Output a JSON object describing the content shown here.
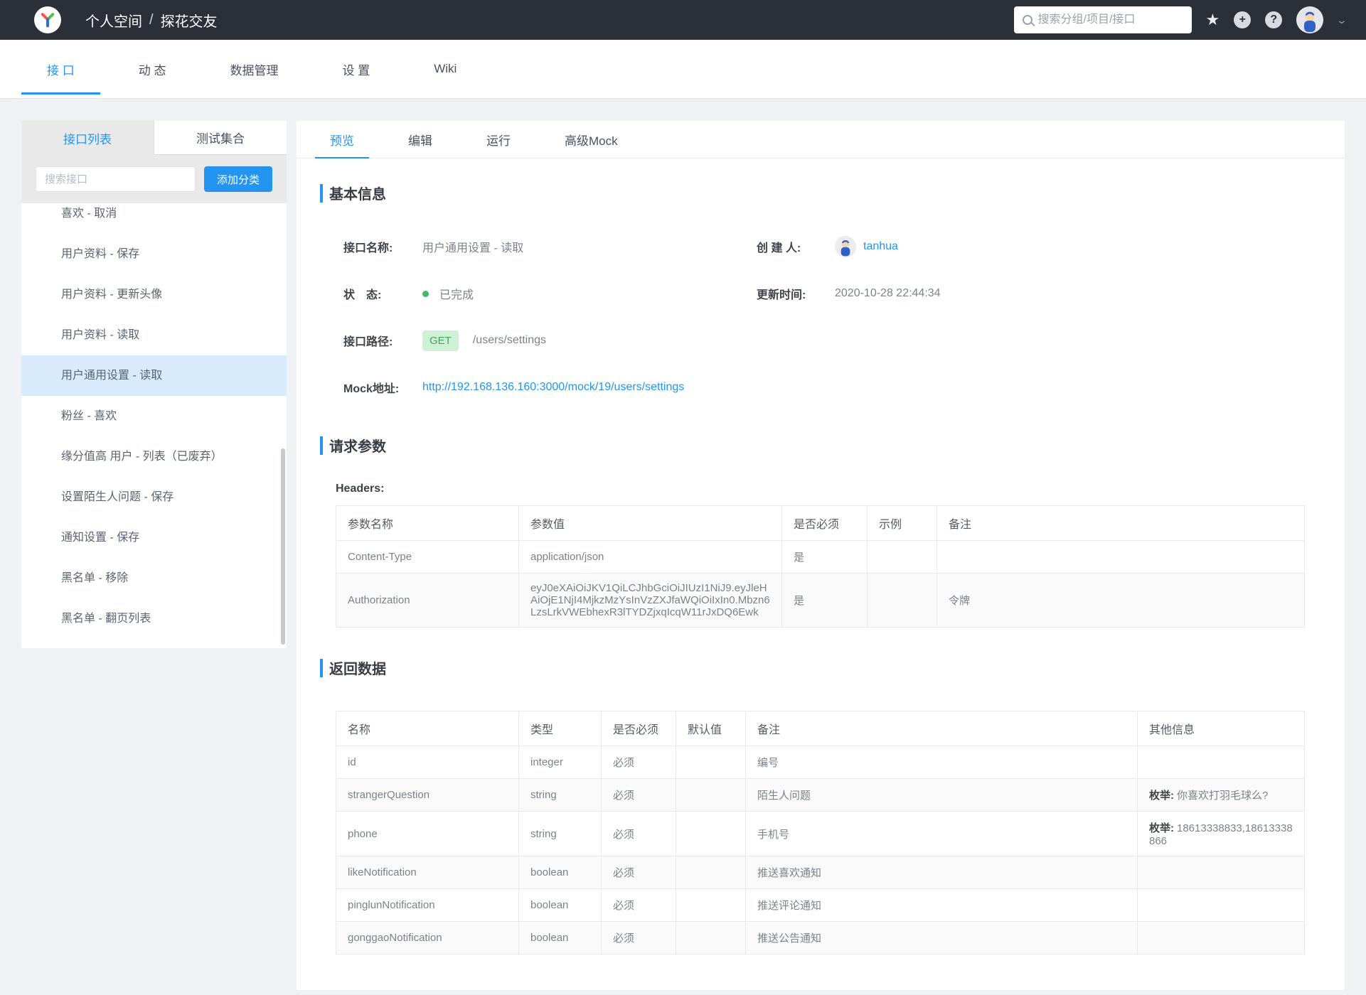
{
  "topbar": {
    "breadcrumb": {
      "group": "个人空间",
      "separator": "/",
      "project": "探花交友"
    },
    "search_placeholder": "搜索分组/项目/接口"
  },
  "project_nav": {
    "tabs": [
      {
        "label": "接 口",
        "active": true
      },
      {
        "label": "动 态",
        "active": false
      },
      {
        "label": "数据管理",
        "active": false
      },
      {
        "label": "设 置",
        "active": false
      },
      {
        "label": "Wiki",
        "active": false
      }
    ]
  },
  "sidebar": {
    "tabs": [
      {
        "label": "接口列表",
        "active": true
      },
      {
        "label": "测试集合",
        "active": false
      }
    ],
    "search_placeholder": "搜索接口",
    "add_button": "添加分类",
    "items": [
      {
        "label": "喜欢 - 取消",
        "selected": false
      },
      {
        "label": "用户资料 - 保存",
        "selected": false
      },
      {
        "label": "用户资料 - 更新头像",
        "selected": false
      },
      {
        "label": "用户资料 - 读取",
        "selected": false
      },
      {
        "label": "用户通用设置 - 读取",
        "selected": true
      },
      {
        "label": "粉丝 - 喜欢",
        "selected": false
      },
      {
        "label": "缘分值高 用户 - 列表（已废弃）",
        "selected": false
      },
      {
        "label": "设置陌生人问题 - 保存",
        "selected": false
      },
      {
        "label": "通知设置 - 保存",
        "selected": false
      },
      {
        "label": "黑名单 - 移除",
        "selected": false
      },
      {
        "label": "黑名单 - 翻页列表",
        "selected": false
      }
    ]
  },
  "main": {
    "tabs": [
      {
        "label": "预览",
        "active": true
      },
      {
        "label": "编辑",
        "active": false
      },
      {
        "label": "运行",
        "active": false
      },
      {
        "label": "高级Mock",
        "active": false
      }
    ],
    "basic_info": {
      "title": "基本信息",
      "name_label": "接口名称:",
      "name_value": "用户通用设置 - 读取",
      "creator_label": "创 建 人:",
      "creator_name": "tanhua",
      "status_label": "状　态:",
      "status_value": "已完成",
      "updated_label": "更新时间:",
      "updated_value": "2020-10-28 22:44:34",
      "path_label": "接口路径:",
      "method": "GET",
      "path_value": "/users/settings",
      "mock_label": "Mock地址:",
      "mock_url": "http://192.168.136.160:3000/mock/19/users/settings"
    },
    "request_params": {
      "title": "请求参数",
      "headers_label": "Headers:",
      "columns": [
        "参数名称",
        "参数值",
        "是否必须",
        "示例",
        "备注"
      ],
      "rows": [
        {
          "name": "Content-Type",
          "value": "application/json",
          "required": "是",
          "example": "",
          "remark": ""
        },
        {
          "name": "Authorization",
          "value": "eyJ0eXAiOiJKV1QiLCJhbGciOiJIUzI1NiJ9.eyJleHAiOjE1NjI4MjkzMzYsInVzZXJfaWQiOiIxIn0.Mbzn6LzsLrkVWEbhexR3lTYDZjxqIcqW11rJxDQ6Ewk",
          "required": "是",
          "example": "",
          "remark": "令牌"
        }
      ]
    },
    "response_data": {
      "title": "返回数据",
      "columns": [
        "名称",
        "类型",
        "是否必须",
        "默认值",
        "备注",
        "其他信息"
      ],
      "rows": [
        {
          "name": "id",
          "type": "integer",
          "required": "必须",
          "default": "",
          "remark": "编号",
          "enum_label": "",
          "enum_value": ""
        },
        {
          "name": "strangerQuestion",
          "type": "string",
          "required": "必须",
          "default": "",
          "remark": "陌生人问题",
          "enum_label": "枚举:",
          "enum_value": "你喜欢打羽毛球么?"
        },
        {
          "name": "phone",
          "type": "string",
          "required": "必须",
          "default": "",
          "remark": "手机号",
          "enum_label": "枚举:",
          "enum_value": "18613338833,18613338866"
        },
        {
          "name": "likeNotification",
          "type": "boolean",
          "required": "必须",
          "default": "",
          "remark": "推送喜欢通知",
          "enum_label": "",
          "enum_value": ""
        },
        {
          "name": "pinglunNotification",
          "type": "boolean",
          "required": "必须",
          "default": "",
          "remark": "推送评论通知",
          "enum_label": "",
          "enum_value": ""
        },
        {
          "name": "gonggaoNotification",
          "type": "boolean",
          "required": "必须",
          "default": "",
          "remark": "推送公告通知",
          "enum_label": "",
          "enum_value": ""
        }
      ]
    }
  },
  "colors": {
    "accent_blue": "#2395f1",
    "topbar_bg": "#2b2f38",
    "status_done_green": "#41ba61",
    "method_get_bg": "#cdf1d7",
    "method_get_text": "#42a65c",
    "selected_item_bg": "#d7ebfc"
  }
}
